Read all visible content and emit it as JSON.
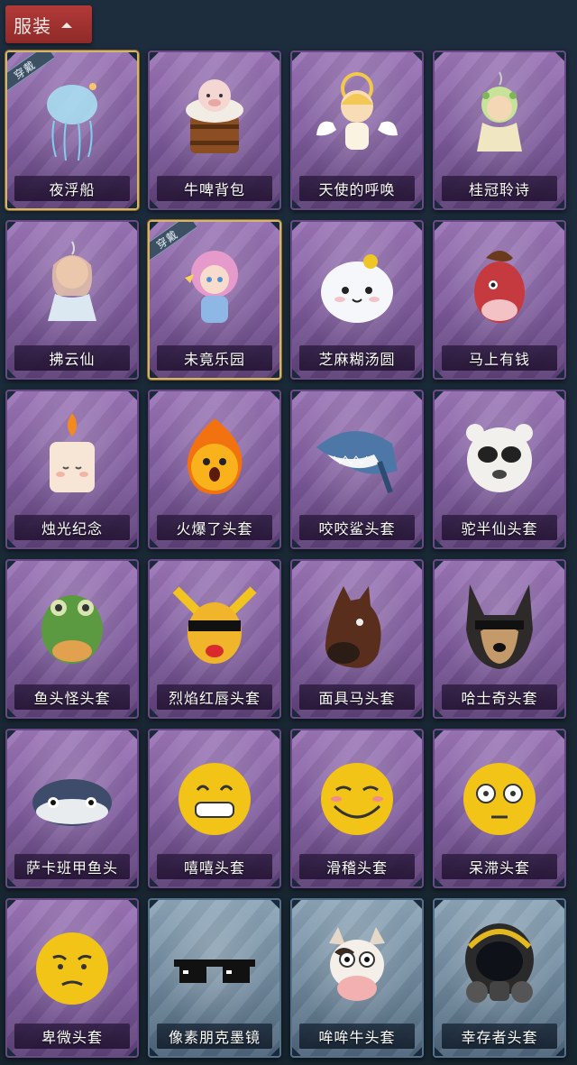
{
  "header": {
    "label": "服装",
    "arrow_icon": "chevron-up-icon"
  },
  "items": [
    {
      "name": "夜浮船",
      "frame": "purple",
      "equipped": true,
      "equip_badge": "穿戴",
      "icon": "jellyfish-icon"
    },
    {
      "name": "牛啤背包",
      "frame": "purple",
      "equipped": false,
      "icon": "beer-barrel-cow-icon"
    },
    {
      "name": "天使的呼唤",
      "frame": "purple",
      "equipped": false,
      "icon": "angel-icon"
    },
    {
      "name": "桂冠聆诗",
      "frame": "purple",
      "equipped": false,
      "icon": "laurel-fairy-icon"
    },
    {
      "name": "拂云仙",
      "frame": "purple",
      "equipped": false,
      "icon": "cloud-fairy-icon"
    },
    {
      "name": "未竟乐园",
      "frame": "purple",
      "equipped": true,
      "equip_badge": "穿戴",
      "icon": "pink-hair-girl-icon"
    },
    {
      "name": "芝麻糊汤圆",
      "frame": "purple",
      "equipped": false,
      "icon": "rice-ball-icon"
    },
    {
      "name": "马上有钱",
      "frame": "purple",
      "equipped": false,
      "icon": "red-horse-icon"
    },
    {
      "name": "烛光纪念",
      "frame": "purple",
      "equipped": false,
      "icon": "candle-icon"
    },
    {
      "name": "火爆了头套",
      "frame": "purple",
      "equipped": false,
      "icon": "fireball-icon"
    },
    {
      "name": "咬咬鲨头套",
      "frame": "purple",
      "equipped": false,
      "icon": "shark-icon"
    },
    {
      "name": "驼半仙头套",
      "frame": "purple",
      "equipped": false,
      "icon": "sunglasses-bear-icon"
    },
    {
      "name": "鱼头怪头套",
      "frame": "purple",
      "equipped": false,
      "icon": "fish-head-icon"
    },
    {
      "name": "烈焰红唇头套",
      "frame": "purple",
      "equipped": false,
      "icon": "yellow-mask-icon"
    },
    {
      "name": "面具马头套",
      "frame": "purple",
      "equipped": false,
      "icon": "horse-mask-icon"
    },
    {
      "name": "哈士奇头套",
      "frame": "purple",
      "equipped": false,
      "icon": "husky-icon"
    },
    {
      "name": "萨卡班甲鱼头",
      "frame": "purple",
      "equipped": false,
      "icon": "sacabambaspis-icon"
    },
    {
      "name": "嘻嘻头套",
      "frame": "purple",
      "equipped": false,
      "icon": "grin-emoji-icon"
    },
    {
      "name": "滑稽头套",
      "frame": "purple",
      "equipped": false,
      "icon": "funny-emoji-icon"
    },
    {
      "name": "呆滞头套",
      "frame": "purple",
      "equipped": false,
      "icon": "dazed-emoji-icon"
    },
    {
      "name": "卑微头套",
      "frame": "purple",
      "equipped": false,
      "icon": "humble-emoji-icon"
    },
    {
      "name": "像素朋克墨镜",
      "frame": "blue",
      "equipped": false,
      "icon": "pixel-sunglasses-icon"
    },
    {
      "name": "哞哞牛头套",
      "frame": "blue",
      "equipped": false,
      "icon": "cow-head-icon"
    },
    {
      "name": "幸存者头套",
      "frame": "blue",
      "equipped": false,
      "icon": "gas-mask-helmet-icon"
    }
  ]
}
